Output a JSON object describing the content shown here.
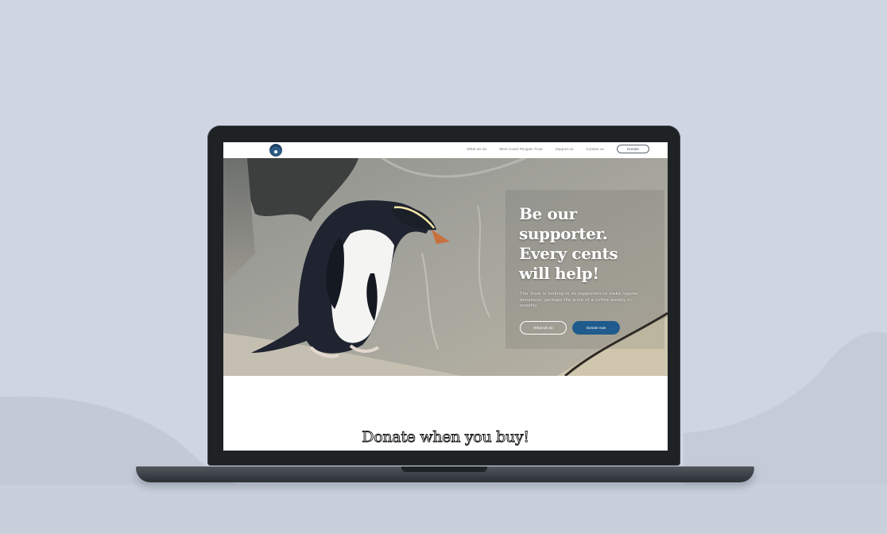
{
  "site": {
    "nav": {
      "links": [
        "What we do",
        "West Coast Penguin Trust",
        "Support us",
        "Contact us"
      ],
      "donate_button": "Donate"
    },
    "hero": {
      "title_lines": [
        "Be our",
        "supporter.",
        "Every cents",
        "will help!"
      ],
      "text": "The Trust is looking to its supporters to make regular donations, perhaps the price of a coffee weekly or monthly.",
      "button_secondary": "What we do",
      "button_primary": "Donate now"
    },
    "section": {
      "title": "Donate when you buy!"
    }
  },
  "colors": {
    "page_background": "#cfd6e2",
    "laptop_body": "#1e2225",
    "primary_button": "#1f5b8c"
  },
  "icons": {
    "logo": "penguin-trust-logo"
  }
}
